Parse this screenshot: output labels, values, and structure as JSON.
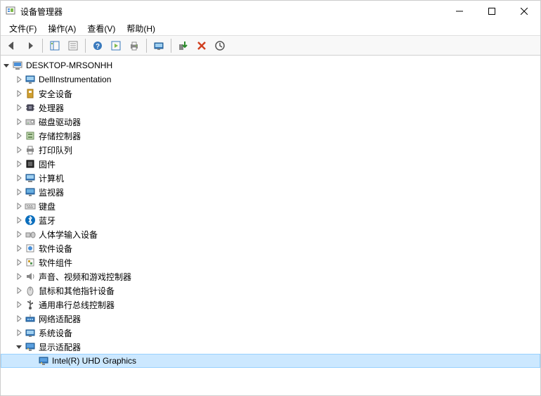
{
  "window": {
    "title": "设备管理器"
  },
  "menu": {
    "file": "文件(F)",
    "action": "操作(A)",
    "view": "查看(V)",
    "help": "帮助(H)"
  },
  "tree": {
    "root": {
      "label": "DESKTOP-MRSONHH",
      "expanded": true
    },
    "children": [
      {
        "label": "DellInstrumentation",
        "icon": "monitor"
      },
      {
        "label": "安全设备",
        "icon": "security"
      },
      {
        "label": "处理器",
        "icon": "cpu"
      },
      {
        "label": "磁盘驱动器",
        "icon": "disk"
      },
      {
        "label": "存储控制器",
        "icon": "storage"
      },
      {
        "label": "打印队列",
        "icon": "printer"
      },
      {
        "label": "固件",
        "icon": "firmware"
      },
      {
        "label": "计算机",
        "icon": "computer"
      },
      {
        "label": "监视器",
        "icon": "monitor2"
      },
      {
        "label": "键盘",
        "icon": "keyboard"
      },
      {
        "label": "蓝牙",
        "icon": "bluetooth"
      },
      {
        "label": "人体学输入设备",
        "icon": "hid"
      },
      {
        "label": "软件设备",
        "icon": "software"
      },
      {
        "label": "软件组件",
        "icon": "component"
      },
      {
        "label": "声音、视频和游戏控制器",
        "icon": "sound"
      },
      {
        "label": "鼠标和其他指针设备",
        "icon": "mouse"
      },
      {
        "label": "通用串行总线控制器",
        "icon": "usb"
      },
      {
        "label": "网络适配器",
        "icon": "network"
      },
      {
        "label": "系统设备",
        "icon": "system"
      },
      {
        "label": "显示适配器",
        "icon": "display",
        "expanded": true,
        "children": [
          {
            "label": "Intel(R) UHD Graphics",
            "icon": "display",
            "selected": true
          }
        ]
      }
    ]
  }
}
